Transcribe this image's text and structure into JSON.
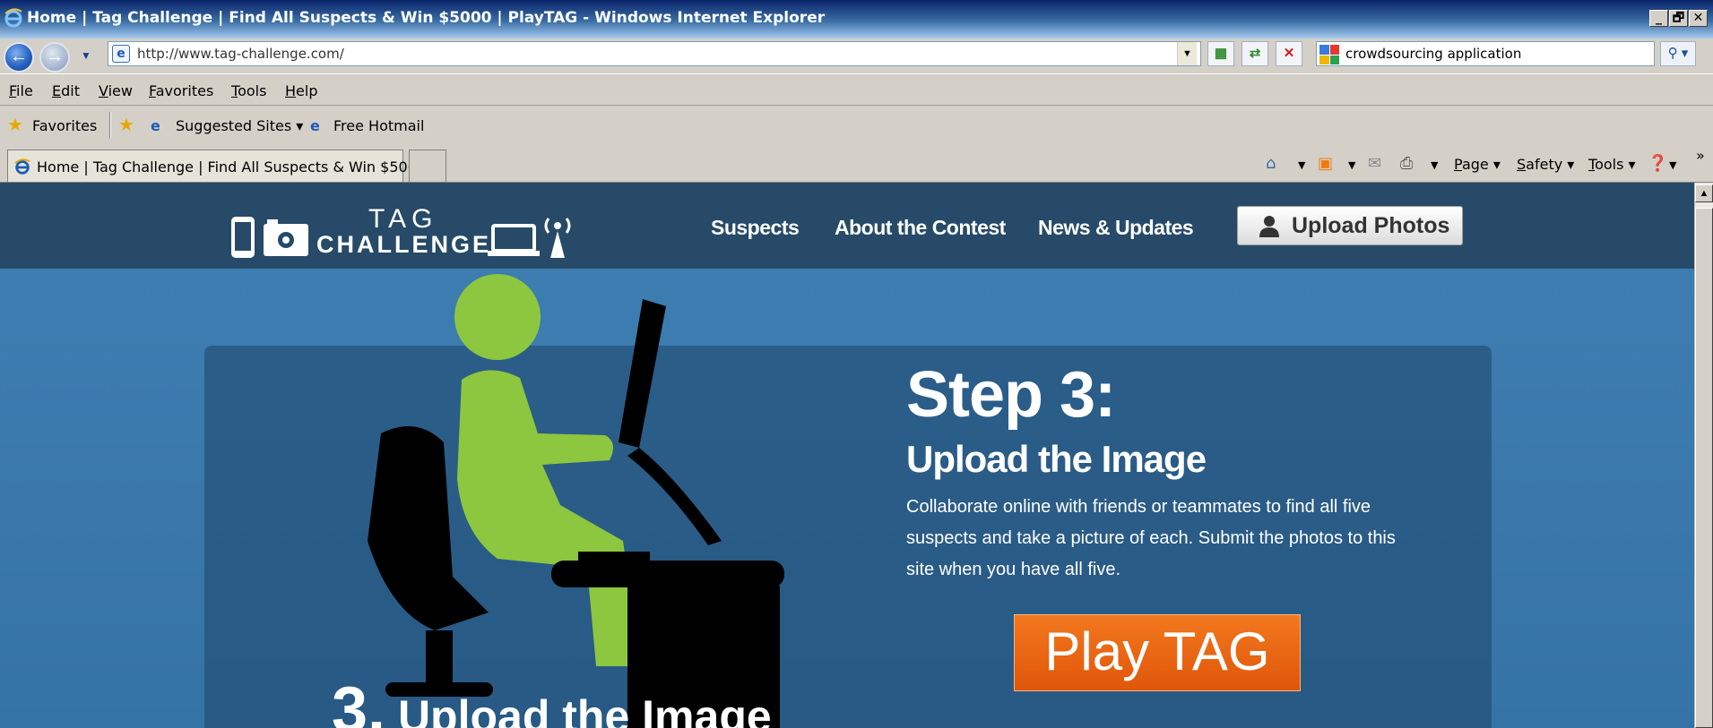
{
  "window": {
    "title": "Home | Tag Challenge | Find All Suspects & Win $5000 | PlayTAG - Windows Internet Explorer",
    "controls": [
      "_",
      "🗗",
      "✕"
    ]
  },
  "address_bar": {
    "url": "http://www.tag-challenge.com/",
    "search_value": "crowdsourcing application"
  },
  "menu": [
    "File",
    "Edit",
    "View",
    "Favorites",
    "Tools",
    "Help"
  ],
  "favorites_bar": {
    "favorites_label": "Favorites",
    "suggested_sites": "Suggested Sites ▾",
    "free_hotmail": "Free Hotmail"
  },
  "tabs": {
    "active_title": "Home | Tag Challenge | Find All Suspects & Win $5000..."
  },
  "command_bar": {
    "page": "Page ▾",
    "safety": "Safety ▾",
    "tools": "Tools ▾"
  },
  "site": {
    "logo_tag": "TAG",
    "logo_challenge": "CHALLENGE",
    "nav": [
      "Suspects",
      "About the Contest",
      "News & Updates"
    ],
    "upload_button": "Upload Photos",
    "step_title": "Step 3:",
    "step_subtitle": "Upload the Image",
    "step_description": "Collaborate online with friends or teammates to find all five suspects and take a picture of each. Submit the photos to this site when you have all five.",
    "play_button": "Play TAG",
    "bottom_step_number": "3.",
    "bottom_step_text": "Upload the Image"
  },
  "colors": {
    "header_bg": "#264a68",
    "body_bg": "#3a78ab",
    "accent_green": "#8dc63f",
    "play_orange": "#e8620f"
  }
}
